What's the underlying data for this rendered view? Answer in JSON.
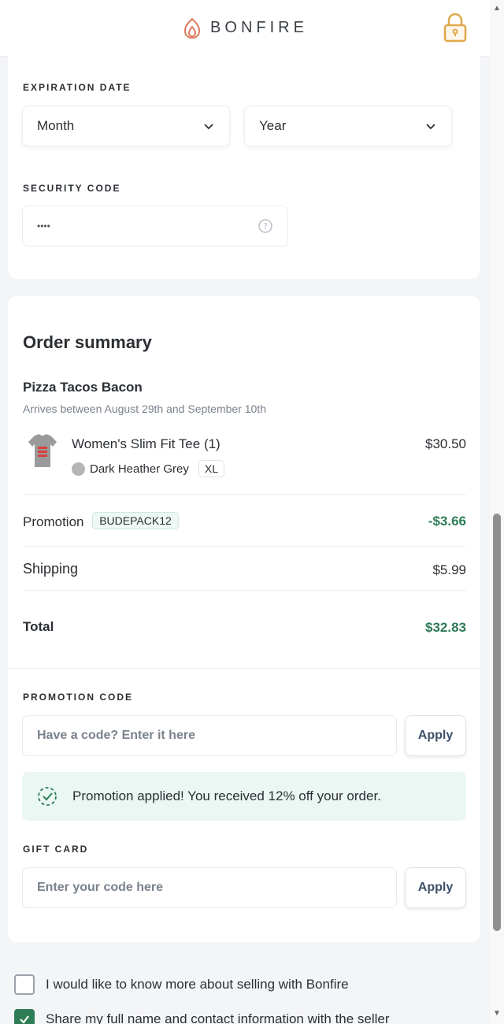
{
  "header": {
    "brand": "BONFIRE"
  },
  "payment": {
    "expiration_label": "EXPIRATION DATE",
    "month_value": "Month",
    "year_value": "Year",
    "security_label": "SECURITY CODE",
    "security_value": "••••"
  },
  "order": {
    "title": "Order summary",
    "campaign": "Pizza Tacos Bacon",
    "arrival": "Arrives between August 29th and September 10th",
    "item_name": "Women's Slim Fit Tee (1)",
    "item_color": "Dark Heather Grey",
    "item_size": "XL",
    "item_price": "$30.50",
    "promotion_label": "Promotion",
    "promotion_code": "BUDEPACK12",
    "promotion_amount": "-$3.66",
    "shipping_label": "Shipping",
    "shipping_amount": "$5.99",
    "total_label": "Total",
    "total_amount": "$32.83"
  },
  "promo": {
    "label": "PROMOTION CODE",
    "placeholder": "Have a code? Enter it here",
    "apply": "Apply",
    "notice": "Promotion applied! You received 12% off your order."
  },
  "gift": {
    "label": "GIFT CARD",
    "placeholder": "Enter your code here",
    "apply": "Apply"
  },
  "options": {
    "selling_info": "I would like to know more about selling with Bonfire",
    "share_info": "Share my full name and contact information with the seller"
  },
  "colors": {
    "accent_green": "#2e7d57",
    "brand_orange": "#e07a5f",
    "lock_gold": "#e0a94a"
  }
}
